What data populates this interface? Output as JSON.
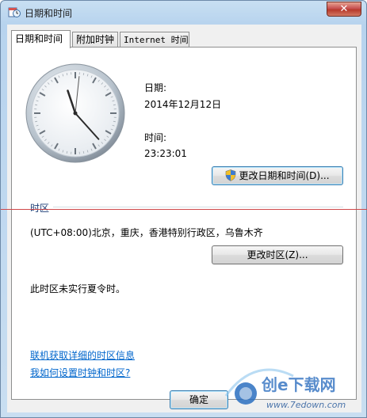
{
  "window": {
    "title": "日期和时间",
    "close_glyph": "✕"
  },
  "tabs": [
    {
      "label": "日期和时间",
      "active": true
    },
    {
      "label": "附加时钟",
      "active": false
    },
    {
      "label": "Internet 时间",
      "active": false
    }
  ],
  "date": {
    "label": "日期:",
    "value": "2014年12月12日"
  },
  "time": {
    "label": "时间:",
    "value": "23:23:01"
  },
  "clock": {
    "hour": 23,
    "minute": 23,
    "second": 1
  },
  "change_datetime_button": "更改日期和时间(D)...",
  "timezone": {
    "section_label": "时区",
    "value": "(UTC+08:00)北京，重庆，香港特别行政区，乌鲁木齐",
    "change_button": "更改时区(Z)...",
    "dst_note": "此时区未实行夏令时。"
  },
  "links": {
    "online_info": "联机获取详细的时区信息",
    "how_to_set": "我如何设置时钟和时区?"
  },
  "buttons": {
    "ok": "确定"
  },
  "watermark": {
    "brand": "创e下载网",
    "url": "www.7edown.com"
  },
  "colors": {
    "link": "#0066cc",
    "titlebar": "#b7d3ee",
    "close": "#c75050"
  }
}
